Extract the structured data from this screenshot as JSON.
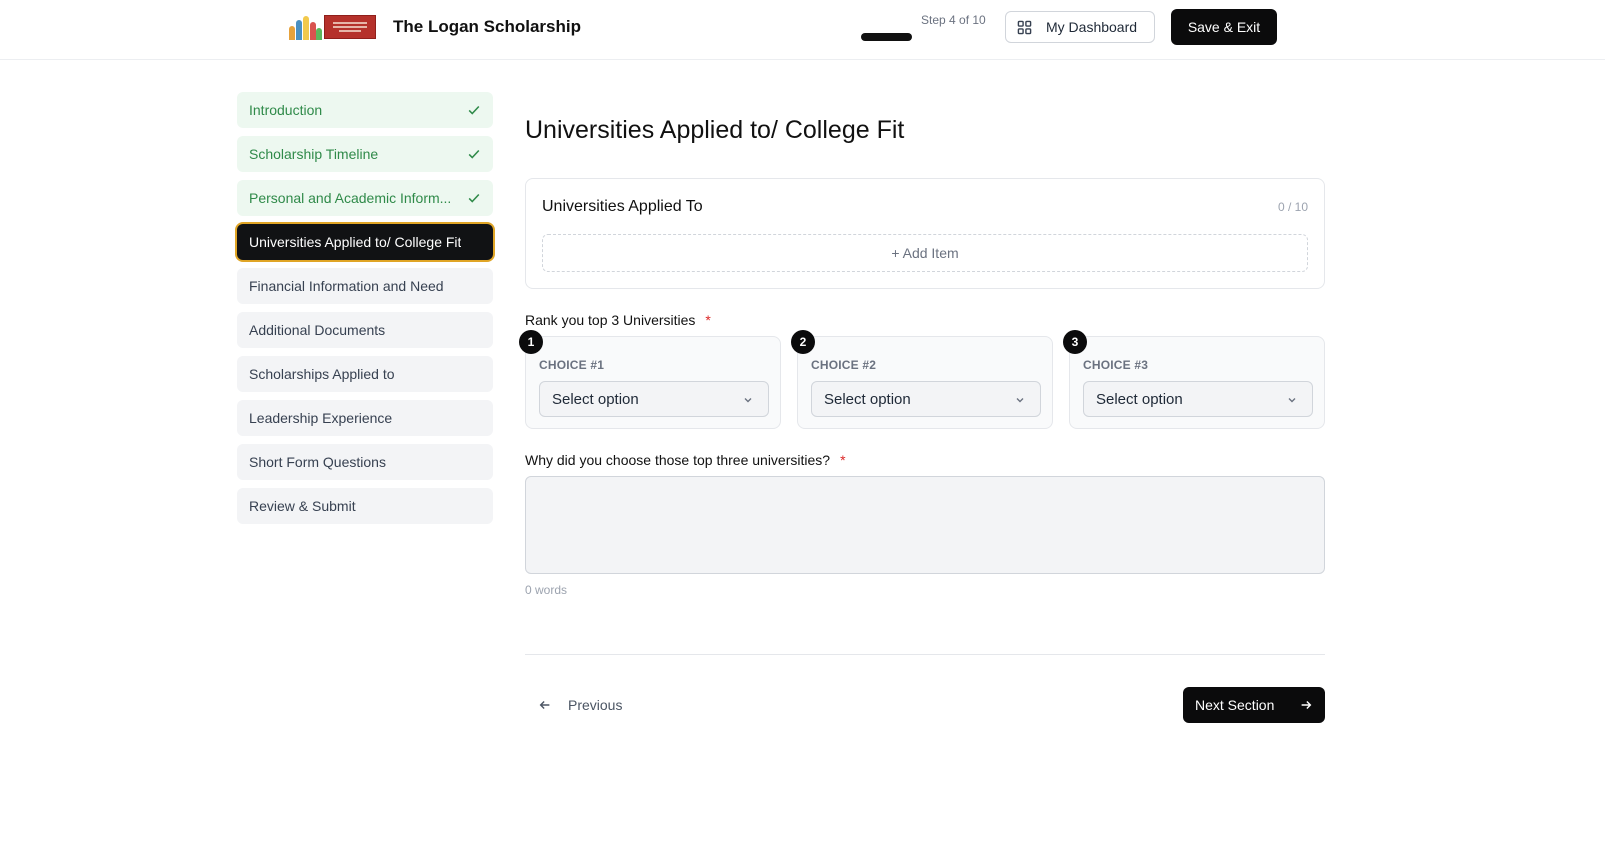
{
  "header": {
    "app_title": "The Logan Scholarship",
    "step_text": "Step 4 of 10",
    "progress_fraction": 0.4,
    "dashboard_label": "My Dashboard",
    "save_exit_label": "Save & Exit"
  },
  "sidebar": {
    "items": [
      {
        "label": "Introduction",
        "status": "complete"
      },
      {
        "label": "Scholarship Timeline",
        "status": "complete"
      },
      {
        "label": "Personal and Academic Inform...",
        "status": "complete"
      },
      {
        "label": "Universities Applied to/ College Fit",
        "status": "active"
      },
      {
        "label": "Financial Information and Need",
        "status": "pending"
      },
      {
        "label": "Additional Documents",
        "status": "pending"
      },
      {
        "label": "Scholarships Applied to",
        "status": "pending"
      },
      {
        "label": "Leadership Experience",
        "status": "pending"
      },
      {
        "label": "Short Form Questions",
        "status": "pending"
      },
      {
        "label": "Review & Submit",
        "status": "pending"
      }
    ]
  },
  "main": {
    "page_title": "Universities Applied to/ College Fit",
    "universities_card": {
      "title": "Universities Applied To",
      "count": "0 / 10",
      "add_item_label": "+ Add Item"
    },
    "rank": {
      "label": "Rank you top 3 Universities",
      "required_mark": "*",
      "choices": [
        {
          "badge": "1",
          "label": "CHOICE #1",
          "value": "Select option"
        },
        {
          "badge": "2",
          "label": "CHOICE #2",
          "value": "Select option"
        },
        {
          "badge": "3",
          "label": "CHOICE #3",
          "value": "Select option"
        }
      ]
    },
    "why": {
      "label": "Why did you choose those top three universities?",
      "required_mark": "*",
      "value": "",
      "word_count": "0 words"
    },
    "footer": {
      "previous_label": "Previous",
      "next_label": "Next Section"
    }
  },
  "colors": {
    "accent_dark": "#0b0b0c",
    "complete_bg": "#edf8f0",
    "complete_text": "#2f8a49",
    "active_outline": "#e0a526",
    "required": "#dc2626"
  }
}
